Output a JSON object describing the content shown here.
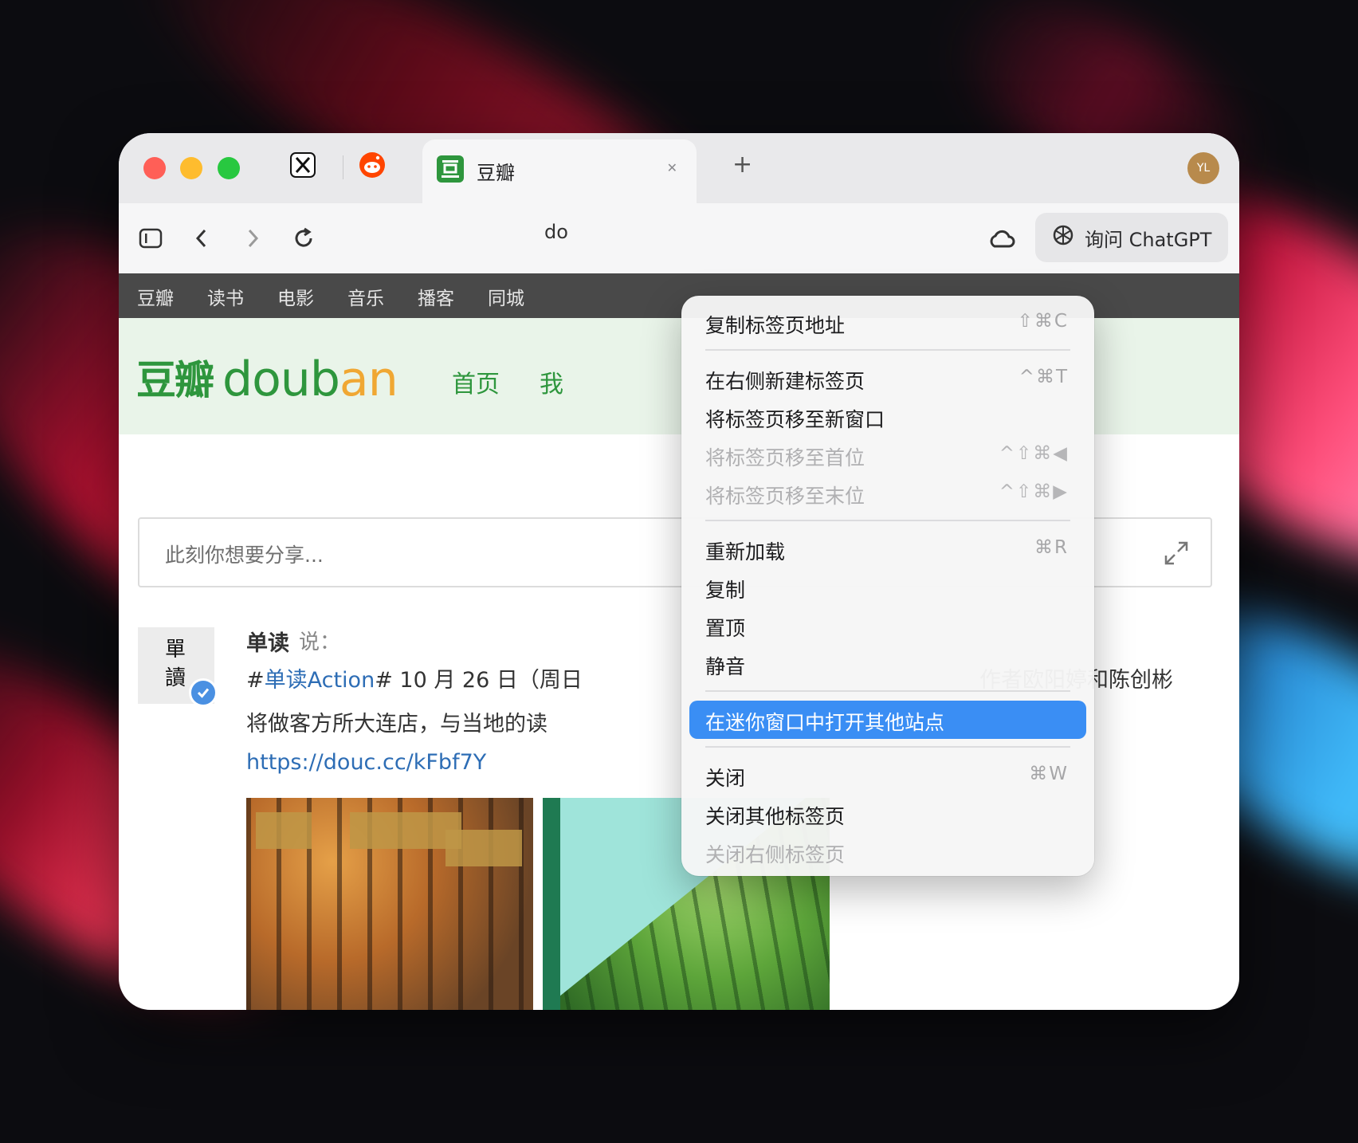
{
  "browser": {
    "pinned_tabs": [
      {
        "icon": "x-logo-icon"
      },
      {
        "icon": "reddit-logo-icon"
      }
    ],
    "active_tab": {
      "title": "豆瓣",
      "icon": "douban-logo-icon"
    },
    "avatar_initials": "YL",
    "url_text": "do",
    "chatgpt_button": "询问 ChatGPT"
  },
  "site_nav": [
    "豆瓣",
    "读书",
    "电影",
    "音乐",
    "播客",
    "同城"
  ],
  "site_header": {
    "logo_cn": "豆瓣",
    "logo_en_green": "doub",
    "logo_en_orange": "an",
    "links": [
      "首页",
      "我"
    ]
  },
  "share": {
    "placeholder": "此刻你想要分享..."
  },
  "feed": {
    "avatar_text_1": "單",
    "avatar_text_2": "讀",
    "author": "单读",
    "says": "说：",
    "line1_prefix": "#",
    "line1_tag": "单读Action",
    "line1_rest": "# 10 月 26 日（周日",
    "line1_tail": "作者欧阳婷和陈创彬",
    "line2": "将做客方所大连店，与当地的读",
    "link": "https://douc.cc/kFbf7Y"
  },
  "context_menu": {
    "items": [
      {
        "label": "复制标签页地址",
        "shortcut": "⇧⌘C",
        "enabled": true
      },
      {
        "label": "在右侧新建标签页",
        "shortcut": "^⌘T",
        "enabled": true
      },
      {
        "label": "将标签页移至新窗口",
        "shortcut": "",
        "enabled": true
      },
      {
        "label": "将标签页移至首位",
        "shortcut": "^⇧⌘◀",
        "enabled": false
      },
      {
        "label": "将标签页移至末位",
        "shortcut": "^⇧⌘▶",
        "enabled": false
      },
      {
        "label": "重新加载",
        "shortcut": "⌘R",
        "enabled": true
      },
      {
        "label": "复制",
        "shortcut": "",
        "enabled": true
      },
      {
        "label": "置顶",
        "shortcut": "",
        "enabled": true
      },
      {
        "label": "静音",
        "shortcut": "",
        "enabled": true
      },
      {
        "label": "在迷你窗口中打开其他站点",
        "shortcut": "",
        "enabled": true,
        "highlighted": true
      },
      {
        "label": "关闭",
        "shortcut": "⌘W",
        "enabled": true
      },
      {
        "label": "关闭其他标签页",
        "shortcut": "",
        "enabled": true
      },
      {
        "label": "关闭右侧标签页",
        "shortcut": "",
        "enabled": false
      }
    ]
  },
  "colors": {
    "douban_green": "#2e963d",
    "menu_highlight": "#3a8ef4",
    "link_blue": "#2d6db5"
  }
}
